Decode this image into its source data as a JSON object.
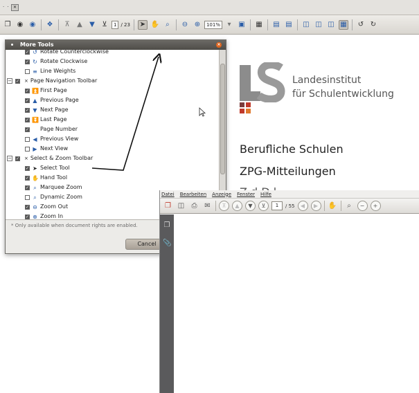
{
  "top_strip": {
    "label": "· ·",
    "box": "✕"
  },
  "toolbar": {
    "page_current": "1",
    "page_total": "/ 23",
    "zoom": "101%"
  },
  "document": {
    "org_line1": "Landesinstitut",
    "org_line2": "für Schulentwicklung",
    "heading1": "Berufliche Schulen",
    "heading2": "ZPG-Mitteilungen",
    "heading3": "Z    d  D    l",
    "logo_colors": [
      "#8c8c8c",
      "#c0392b",
      "#e07a2f",
      "#7a3b3b"
    ]
  },
  "dialog": {
    "title": "More Tools",
    "rows": [
      {
        "label": "Rotate Counterclockwise",
        "checked": true,
        "icon": "rotate-ccw-icon",
        "glyph": "↺",
        "level": 2
      },
      {
        "label": "Rotate Clockwise",
        "checked": true,
        "icon": "rotate-cw-icon",
        "glyph": "↻",
        "level": 2
      },
      {
        "label": "Line Weights",
        "checked": false,
        "icon": "line-weights-icon",
        "glyph": "≡",
        "level": 2
      },
      {
        "label": "Page Navigation Toolbar",
        "checked": true,
        "icon": "",
        "glyph": "",
        "level": 1,
        "group": true
      },
      {
        "label": "First Page",
        "checked": true,
        "icon": "first-page-icon",
        "glyph": "⏫",
        "level": 2
      },
      {
        "label": "Previous Page",
        "checked": true,
        "icon": "previous-page-icon",
        "glyph": "▲",
        "level": 2
      },
      {
        "label": "Next Page",
        "checked": true,
        "icon": "next-page-icon",
        "glyph": "▼",
        "level": 2
      },
      {
        "label": "Last Page",
        "checked": true,
        "icon": "last-page-icon",
        "glyph": "⏬",
        "level": 2
      },
      {
        "label": "Page Number",
        "checked": true,
        "icon": "",
        "glyph": "",
        "level": 2
      },
      {
        "label": "Previous View",
        "checked": false,
        "icon": "previous-view-icon",
        "glyph": "◀",
        "level": 2
      },
      {
        "label": "Next View",
        "checked": false,
        "icon": "next-view-icon",
        "glyph": "▶",
        "level": 2
      },
      {
        "label": "Select & Zoom Toolbar",
        "checked": true,
        "icon": "",
        "glyph": "",
        "level": 1,
        "group": true
      },
      {
        "label": "Select Tool",
        "checked": true,
        "icon": "select-tool-icon",
        "glyph": "➤",
        "level": 2
      },
      {
        "label": "Hand Tool",
        "checked": true,
        "icon": "hand-tool-icon",
        "glyph": "✋",
        "level": 2
      },
      {
        "label": "Marquee Zoom",
        "checked": true,
        "icon": "marquee-zoom-icon",
        "glyph": "⌕",
        "level": 2
      },
      {
        "label": "Dynamic Zoom",
        "checked": false,
        "icon": "dynamic-zoom-icon",
        "glyph": "⌕",
        "level": 2
      },
      {
        "label": "Zoom Out",
        "checked": true,
        "icon": "zoom-out-icon",
        "glyph": "⊖",
        "level": 2
      },
      {
        "label": "Zoom In",
        "checked": true,
        "icon": "zoom-in-icon",
        "glyph": "⊕",
        "level": 2
      }
    ],
    "note": "* Only available when document rights are enabled.",
    "cancel_label": "Cancel"
  },
  "reader": {
    "menu": [
      "Datei",
      "Bearbeiten",
      "Anzeige",
      "Fenster",
      "Hilfe"
    ],
    "page_current": "1",
    "page_total": "/ 55"
  }
}
